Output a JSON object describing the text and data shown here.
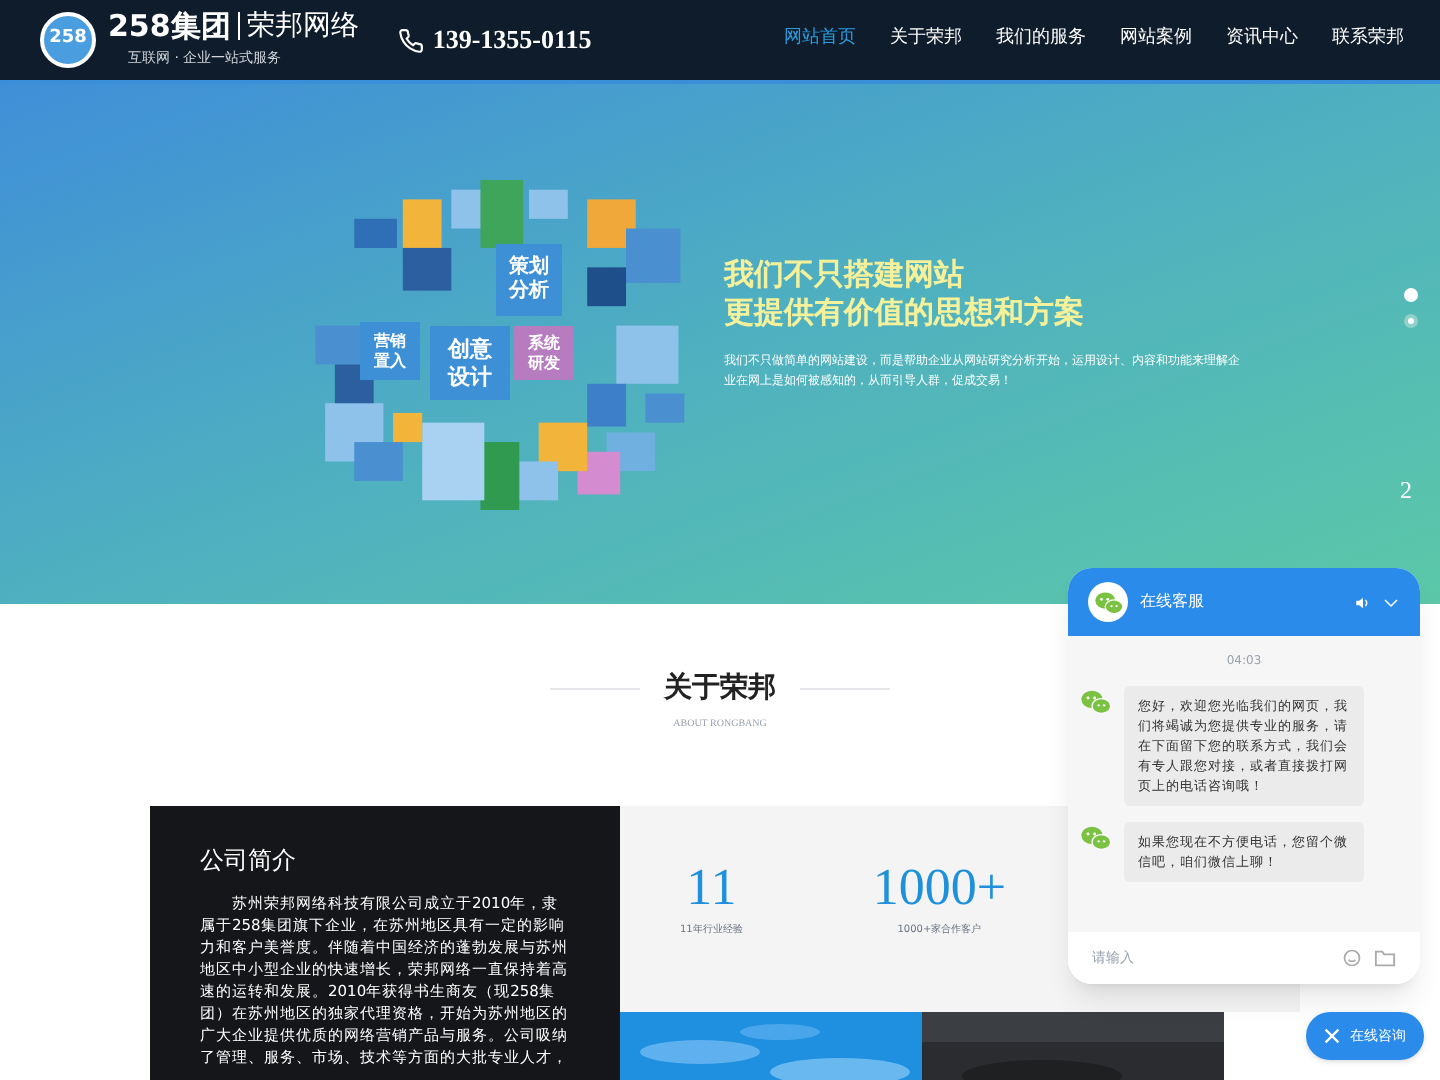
{
  "header": {
    "logo_mark": "258",
    "brand": "258集团",
    "brand_sub": "荣邦网络",
    "tagline": "互联网 · 企业一站式服务",
    "phone": "139-1355-0115",
    "nav": [
      {
        "label": "网站首页",
        "selected": true
      },
      {
        "label": "关于荣邦",
        "selected": false
      },
      {
        "label": "我们的服务",
        "selected": false
      },
      {
        "label": "网站案例",
        "selected": false
      },
      {
        "label": "资讯中心",
        "selected": false
      },
      {
        "label": "联系荣邦",
        "selected": false
      }
    ]
  },
  "hero": {
    "cubes": [
      {
        "label": "策划分析",
        "color": "#3d8fd6"
      },
      {
        "label": "营销置入",
        "color": "#3d8fd6"
      },
      {
        "label": "创意设计",
        "color": "#3d8fd6"
      },
      {
        "label": "系统研发",
        "color": "#b77bc0"
      }
    ],
    "headline": [
      "我们不只搭建网站",
      "更提供有价值的思想和方案"
    ],
    "text": "我们不只做简单的网站建设，而是帮助企业从网站研究分析开始，运用设计、内容和功能来理解企业在网上是如何被感知的，从而引导人群，促成交易！",
    "dots": [
      {
        "selected": false
      },
      {
        "selected": true
      }
    ],
    "page": "2"
  },
  "about": {
    "title": "关于荣邦",
    "subtitle": "ABOUT RONGBANG",
    "intro_title": "公司简介",
    "intro": "苏州荣邦网络科技有限公司成立于2010年，隶属于258集团旗下企业，在苏州地区具有一定的影响力和客户美誉度。伴随着中国经济的蓬勃发展与苏州地区中小型企业的快速增长，荣邦网络一直保持着高速的运转和发展。2010年获得书生商友（现258集团）在苏州地区的独家代理资格，开始为苏州地区的广大企业提供优质的网络营销产品与服务。公司吸纳了管理、服务、市场、技术等方面的大批专业人才，",
    "stats": [
      {
        "value": "11",
        "label": "11年行业经验"
      },
      {
        "value": "1000+",
        "label": "1000+家合作客户"
      }
    ]
  },
  "chat": {
    "title": "在线客服",
    "time": "04:03",
    "messages": [
      "您好，欢迎您光临我们的网页，我们将竭诚为您提供专业的服务，请在下面留下您的联系方式，我们会有专人跟您对接，或者直接拨打网页上的电话咨询哦！",
      "如果您现在不方便电话，您留个微信吧，咱们微信上聊！"
    ],
    "placeholder": "请输入",
    "button": "在线咨询"
  }
}
